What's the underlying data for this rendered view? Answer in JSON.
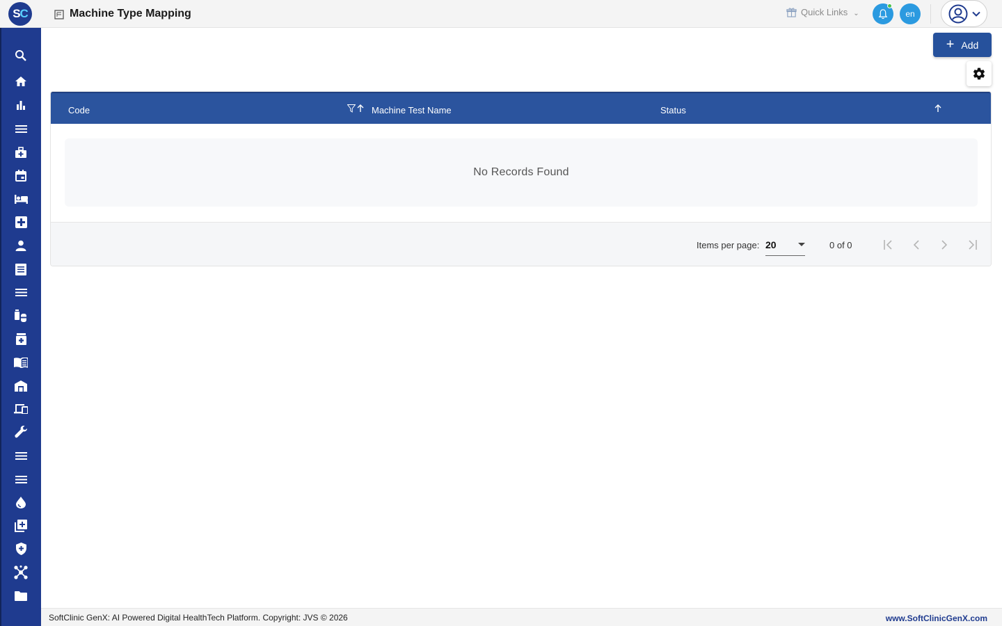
{
  "app": {
    "logo_s": "S",
    "logo_c": "C",
    "page_title": "Machine Type Mapping"
  },
  "header": {
    "quick_links": "Quick Links",
    "language": "en"
  },
  "toolbar": {
    "add_label": "Add"
  },
  "table": {
    "columns": [
      "Code",
      "Machine Test Name",
      "Status"
    ],
    "empty_message": "No Records Found"
  },
  "paginator": {
    "items_per_page_label": "Items per page:",
    "items_per_page": "20",
    "range_label": "0 of 0"
  },
  "footer": {
    "copyright": "SoftClinic GenX: AI Powered Digital HealthTech Platform. Copyright: JVS © 2026",
    "website": "www.SoftClinicGenX.com"
  },
  "sidebar": {
    "icons": [
      "search-icon",
      "home-icon",
      "bar-chart-icon",
      "menu-icon",
      "medical-bag-icon",
      "calendar-icon",
      "bed-icon",
      "medical-cross-icon",
      "person-icon",
      "document-icon",
      "menu-icon",
      "medication-icon",
      "pharmacy-icon",
      "book-icon",
      "store-icon",
      "devices-icon",
      "wrench-icon",
      "menu-icon",
      "menu-icon",
      "blood-drop-icon",
      "add-box-icon",
      "shield-icon",
      "hub-icon",
      "folder-icon"
    ]
  },
  "colors": {
    "brand": "#1f3b8f",
    "table_header": "#2b549e",
    "accent": "#2b9ae0"
  }
}
